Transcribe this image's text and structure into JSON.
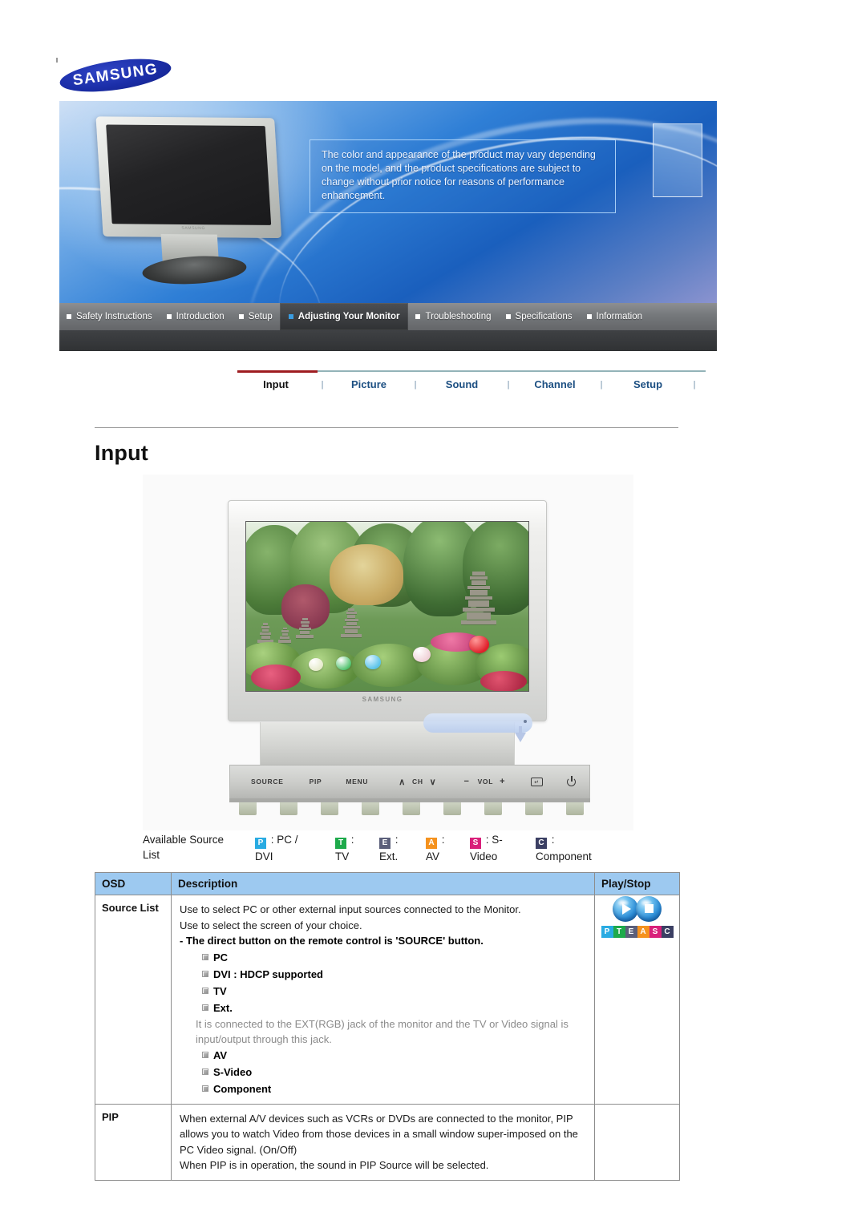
{
  "brand": {
    "name": "SAMSUNG"
  },
  "hero": {
    "note": "The color and appearance of the product may vary depending on the model, and the product specifications are subject to change without prior notice for reasons of performance enhancement.",
    "monitor_logo": "SAMSUNG"
  },
  "nav": {
    "items": [
      {
        "label": "Safety Instructions",
        "active": false
      },
      {
        "label": "Introduction",
        "active": false
      },
      {
        "label": "Setup",
        "active": false
      },
      {
        "label": "Adjusting Your Monitor",
        "active": true
      },
      {
        "label": "Troubleshooting",
        "active": false
      },
      {
        "label": "Specifications",
        "active": false
      },
      {
        "label": "Information",
        "active": false
      }
    ]
  },
  "subnav": {
    "separator": "|",
    "tabs": [
      {
        "label": "Input",
        "active": true
      },
      {
        "label": "Picture",
        "active": false
      },
      {
        "label": "Sound",
        "active": false
      },
      {
        "label": "Channel",
        "active": false
      },
      {
        "label": "Setup",
        "active": false
      }
    ]
  },
  "page": {
    "title": "Input"
  },
  "figure": {
    "monitor_brand": "SAMSUNG",
    "panel_buttons": [
      "SOURCE",
      "PIP",
      "MENU",
      "CH",
      "VOL"
    ],
    "panel_ch_up": "∧",
    "panel_ch_down": "∨",
    "panel_vol_minus": "−",
    "panel_vol_plus": "+",
    "panel_enter_icon": "enter-icon",
    "panel_power_icon": "power-icon"
  },
  "available_source": {
    "label_line1": "Available Source",
    "label_line2": "List",
    "items": [
      {
        "badge": "P",
        "color": "#29abe2",
        "text": ": PC /",
        "text2": "DVI"
      },
      {
        "badge": "T",
        "color": "#1eaa4b",
        "text": ":",
        "text2": "TV"
      },
      {
        "badge": "E",
        "color": "#5b5f7a",
        "text": ":",
        "text2": "Ext."
      },
      {
        "badge": "A",
        "color": "#f5921e",
        "text": ":",
        "text2": "AV"
      },
      {
        "badge": "S",
        "color": "#d91f7a",
        "text": ": S-",
        "text2": "Video"
      },
      {
        "badge": "C",
        "color": "#3b3f63",
        "text": ":",
        "text2": "Component"
      }
    ]
  },
  "table": {
    "headers": {
      "osd": "OSD",
      "description": "Description",
      "playstop": "Play/Stop"
    },
    "rows": [
      {
        "osd": "Source List",
        "lines": [
          {
            "type": "plain",
            "text": "Use to select PC or other external input sources connected to the Monitor."
          },
          {
            "type": "plain",
            "text": "Use to select the screen of your choice."
          },
          {
            "type": "bold",
            "text": "- The direct button on the remote control is 'SOURCE' button."
          },
          {
            "type": "bullet",
            "text": "PC"
          },
          {
            "type": "bullet",
            "text": "DVI : HDCP supported"
          },
          {
            "type": "bullet",
            "text": "TV"
          },
          {
            "type": "bullet",
            "text": "Ext."
          },
          {
            "type": "gray",
            "text": "It is connected to the EXT(RGB) jack of the monitor and the TV or Video signal is input/output through this jack."
          },
          {
            "type": "bullet",
            "text": "AV"
          },
          {
            "type": "bullet",
            "text": "S-Video"
          },
          {
            "type": "bullet",
            "text": "Component"
          }
        ],
        "playstop": {
          "play_icon": "play-icon",
          "stop_icon": "stop-icon",
          "strip": [
            {
              "letter": "P",
              "color": "#29abe2"
            },
            {
              "letter": "T",
              "color": "#1eaa4b"
            },
            {
              "letter": "E",
              "color": "#5b5f7a"
            },
            {
              "letter": "A",
              "color": "#f5921e"
            },
            {
              "letter": "S",
              "color": "#d91f7a"
            },
            {
              "letter": "C",
              "color": "#3b3f63"
            }
          ]
        }
      },
      {
        "osd": "PIP",
        "lines": [
          {
            "type": "plain",
            "text": "When external A/V devices such as VCRs or DVDs are connected to the monitor, PIP allows you to watch Video from those devices in a small window super-imposed on the PC Video signal. (On/Off)"
          },
          {
            "type": "plain",
            "text": "When PIP is in operation, the sound in PIP Source will be selected."
          }
        ],
        "playstop": null
      }
    ]
  }
}
